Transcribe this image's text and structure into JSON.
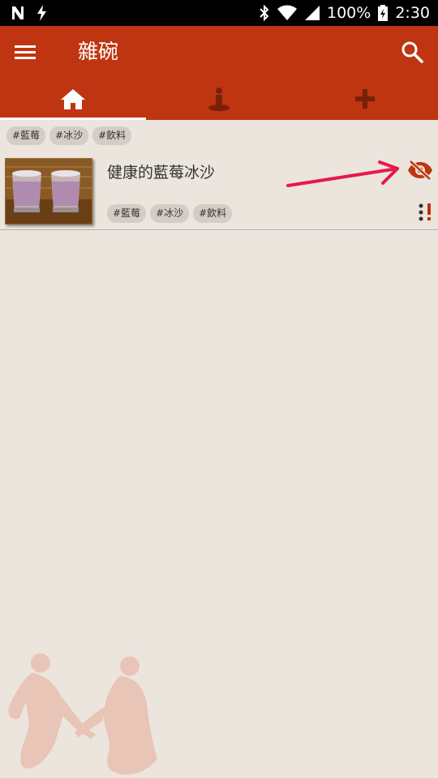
{
  "status_bar": {
    "battery": "100%",
    "time": "2:30"
  },
  "app_bar": {
    "title": "雜碗"
  },
  "tabs": [
    {
      "icon": "home-icon"
    },
    {
      "icon": "person-pin-icon"
    },
    {
      "icon": "add-icon"
    }
  ],
  "filter_tags": [
    "#藍莓",
    "#冰沙",
    "#飲料"
  ],
  "list_items": [
    {
      "title": "健康的藍莓冰沙",
      "tags": [
        "#藍莓",
        "#冰沙",
        "#飲料"
      ]
    }
  ],
  "colors": {
    "primary": "#bf3511",
    "background": "#ebe5de",
    "tag_bg": "#d4cdc6",
    "annotation": "#e8174a"
  }
}
